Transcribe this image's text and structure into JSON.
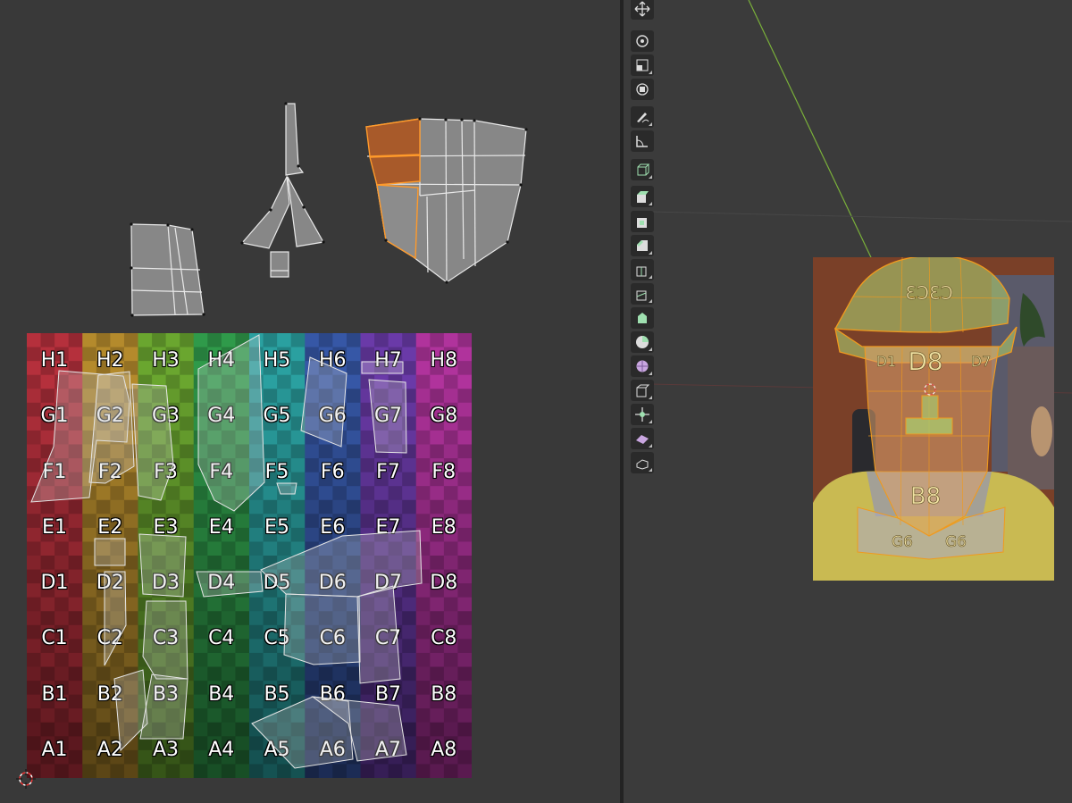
{
  "uv_grid": {
    "rows": [
      "H",
      "G",
      "F",
      "E",
      "D",
      "C",
      "B",
      "A"
    ],
    "cols": [
      "1",
      "2",
      "3",
      "4",
      "5",
      "6",
      "7",
      "8"
    ],
    "labels": [
      [
        "H1",
        "H2",
        "H3",
        "H4",
        "H5",
        "H6",
        "H7",
        "H8"
      ],
      [
        "G1",
        "G2",
        "G3",
        "G4",
        "G5",
        "G6",
        "G7",
        "G8"
      ],
      [
        "F1",
        "F2",
        "F3",
        "F4",
        "F5",
        "F6",
        "F7",
        "F8"
      ],
      [
        "E1",
        "E2",
        "E3",
        "E4",
        "E5",
        "E6",
        "E7",
        "E8"
      ],
      [
        "D1",
        "D2",
        "D3",
        "D4",
        "D5",
        "D6",
        "D7",
        "D8"
      ],
      [
        "C1",
        "C2",
        "C3",
        "C4",
        "C5",
        "C6",
        "C7",
        "C8"
      ],
      [
        "B1",
        "B2",
        "B3",
        "B4",
        "B5",
        "B6",
        "B7",
        "B8"
      ],
      [
        "A1",
        "A2",
        "A3",
        "A4",
        "A5",
        "A6",
        "A7",
        "A8"
      ]
    ],
    "column_colors": [
      "#b5303c",
      "#b48a2c",
      "#6aa62f",
      "#2f9a4a",
      "#2aa0a0",
      "#3657a6",
      "#6a3aa8",
      "#b0339c"
    ]
  },
  "viewport": {
    "face_labels": [
      "D8",
      "B8",
      "C3C3",
      "G6",
      "G6",
      "D1",
      "D7"
    ]
  },
  "toolbar": {
    "tools": [
      {
        "name": "move-tool",
        "icon": "move-icon"
      },
      {
        "name": "rotate-tool",
        "icon": "rotate-icon"
      },
      {
        "name": "scale-tool",
        "icon": "scale-icon"
      },
      {
        "name": "transform-tool",
        "icon": "transform-icon"
      },
      {
        "name": "annotate-tool",
        "icon": "annotate-icon"
      },
      {
        "name": "measure-tool",
        "icon": "measure-icon"
      },
      {
        "name": "add-cube-tool",
        "icon": "add-cube-icon"
      },
      {
        "name": "extrude-region-tool",
        "icon": "extrude-icon"
      },
      {
        "name": "inset-faces-tool",
        "icon": "inset-icon"
      },
      {
        "name": "bevel-tool",
        "icon": "bevel-icon"
      },
      {
        "name": "loop-cut-tool",
        "icon": "loop-cut-icon"
      },
      {
        "name": "knife-tool",
        "icon": "knife-icon"
      },
      {
        "name": "poly-build-tool",
        "icon": "poly-build-icon"
      },
      {
        "name": "spin-tool",
        "icon": "spin-icon"
      },
      {
        "name": "smooth-tool",
        "icon": "smooth-icon"
      },
      {
        "name": "edge-slide-tool",
        "icon": "edge-slide-icon"
      },
      {
        "name": "shrink-fatten-tool",
        "icon": "shrink-fatten-icon"
      },
      {
        "name": "shear-tool",
        "icon": "shear-icon"
      },
      {
        "name": "rip-region-tool",
        "icon": "rip-icon"
      }
    ]
  },
  "colors": {
    "selection_orange": "#e08a1e",
    "editor_bg": "#393939",
    "x_axis_line": "#7ab03a"
  }
}
